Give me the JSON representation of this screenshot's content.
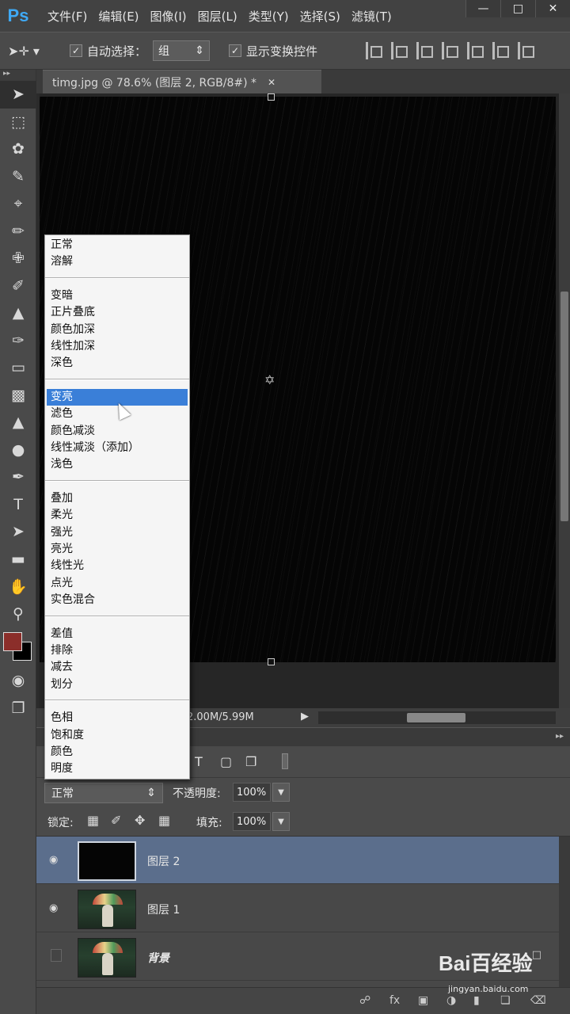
{
  "app": {
    "logo": "Ps"
  },
  "menubar": {
    "items": [
      "文件(F)",
      "编辑(E)",
      "图像(I)",
      "图层(L)",
      "类型(Y)",
      "选择(S)",
      "滤镜(T)"
    ],
    "window_controls": [
      "minimize",
      "maximize",
      "close"
    ]
  },
  "options": {
    "tool_icon": "move-tool-icon",
    "auto_select_label": "自动选择：",
    "auto_select_checked": true,
    "auto_select_value": "组",
    "show_transform_label": "显示变换控件",
    "show_transform_checked": true
  },
  "document": {
    "tab_title": "timg.jpg @ 78.6% (图层 2, RGB/8#) *"
  },
  "status": {
    "doc_size": "2.00M/5.99M"
  },
  "blend_modes": {
    "groups": [
      [
        "正常",
        "溶解"
      ],
      [
        "变暗",
        "正片叠底",
        "颜色加深",
        "线性加深",
        "深色"
      ],
      [
        "变亮",
        "滤色",
        "颜色减淡",
        "线性减淡（添加）",
        "浅色"
      ],
      [
        "叠加",
        "柔光",
        "强光",
        "亮光",
        "线性光",
        "点光",
        "实色混合"
      ],
      [
        "差值",
        "排除",
        "减去",
        "划分"
      ],
      [
        "色相",
        "饱和度",
        "颜色",
        "明度"
      ]
    ],
    "selected": "变亮"
  },
  "layers_panel": {
    "blend_mode": "正常",
    "opacity_label": "不透明度:",
    "opacity_value": "100%",
    "lock_label": "锁定:",
    "fill_label": "填充:",
    "fill_value": "100%",
    "layers": [
      {
        "name": "图层 2",
        "visible": true,
        "selected": true,
        "thumb": "black"
      },
      {
        "name": "图层 1",
        "visible": true,
        "selected": false,
        "thumb": "photo"
      },
      {
        "name": "背景",
        "visible": false,
        "selected": false,
        "thumb": "photo",
        "locked": true
      }
    ]
  },
  "watermark": {
    "main": "Bai百经验",
    "sub": "jingyan.baidu.com"
  },
  "colors": {
    "foreground": "#8b2e2a",
    "background": "#000000",
    "selection": "#3a7fd8",
    "layer_selected": "#5b6e8c"
  }
}
